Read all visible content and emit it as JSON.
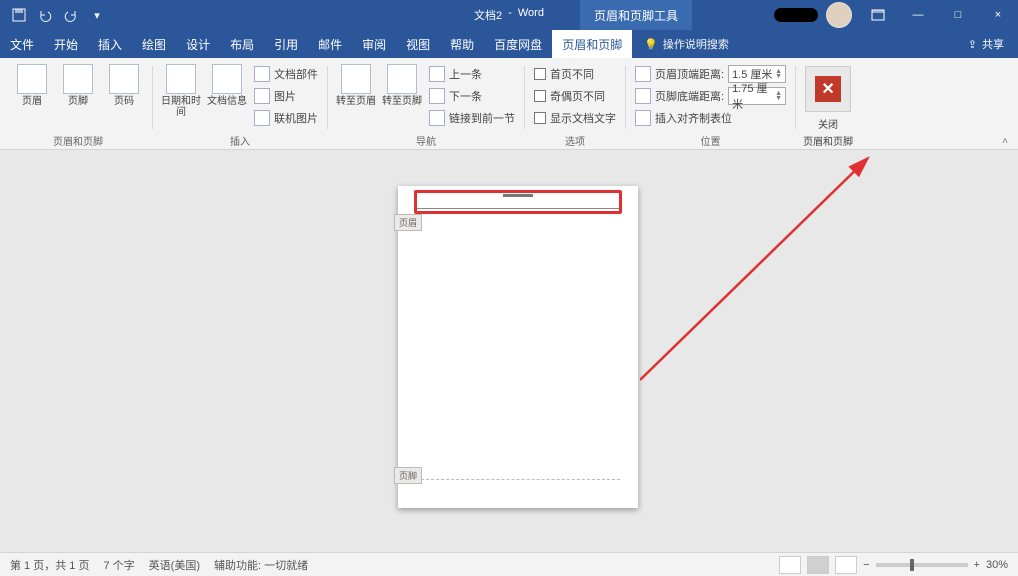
{
  "title": {
    "doc": "文档2",
    "app": "Word",
    "context_tab": "页眉和页脚工具"
  },
  "window": {
    "minimize": "—",
    "maximize": "□",
    "close": "×"
  },
  "tabs": [
    "文件",
    "开始",
    "插入",
    "绘图",
    "设计",
    "布局",
    "引用",
    "邮件",
    "审阅",
    "视图",
    "帮助",
    "百度网盘"
  ],
  "active_tab": "页眉和页脚",
  "tell_me": "操作说明搜索",
  "share": "共享",
  "ribbon": {
    "g1": {
      "label": "页眉和页脚",
      "b1": "页眉",
      "b2": "页脚",
      "b3": "页码"
    },
    "g2": {
      "label": "插入",
      "b1": "日期和时间",
      "b2": "文档信息",
      "m1": "文档部件",
      "m2": "图片",
      "m3": "联机图片"
    },
    "g3": {
      "label": "导航",
      "b1": "转至页眉",
      "b2": "转至页脚",
      "m1": "上一条",
      "m2": "下一条",
      "m3": "链接到前一节"
    },
    "g4": {
      "label": "选项",
      "c1": "首页不同",
      "c2": "奇偶页不同",
      "c3": "显示文档文字"
    },
    "g5": {
      "label": "位置",
      "r1": "页眉顶端距离:",
      "v1": "1.5 厘米",
      "r2": "页脚底端距离:",
      "v2": "1.75 厘米",
      "r3": "插入对齐制表位"
    },
    "g6": {
      "label": "关闭",
      "b1": "关闭",
      "b2": "页眉和页脚"
    }
  },
  "page": {
    "header_tag": "页眉",
    "footer_tag": "页脚"
  },
  "status": {
    "page": "第 1 页，共 1 页",
    "words": "7 个字",
    "lang": "英语(美国)",
    "acc": "辅助功能: 一切就绪",
    "zoom_out": "−",
    "zoom_in": "+",
    "zoom": "30%"
  }
}
